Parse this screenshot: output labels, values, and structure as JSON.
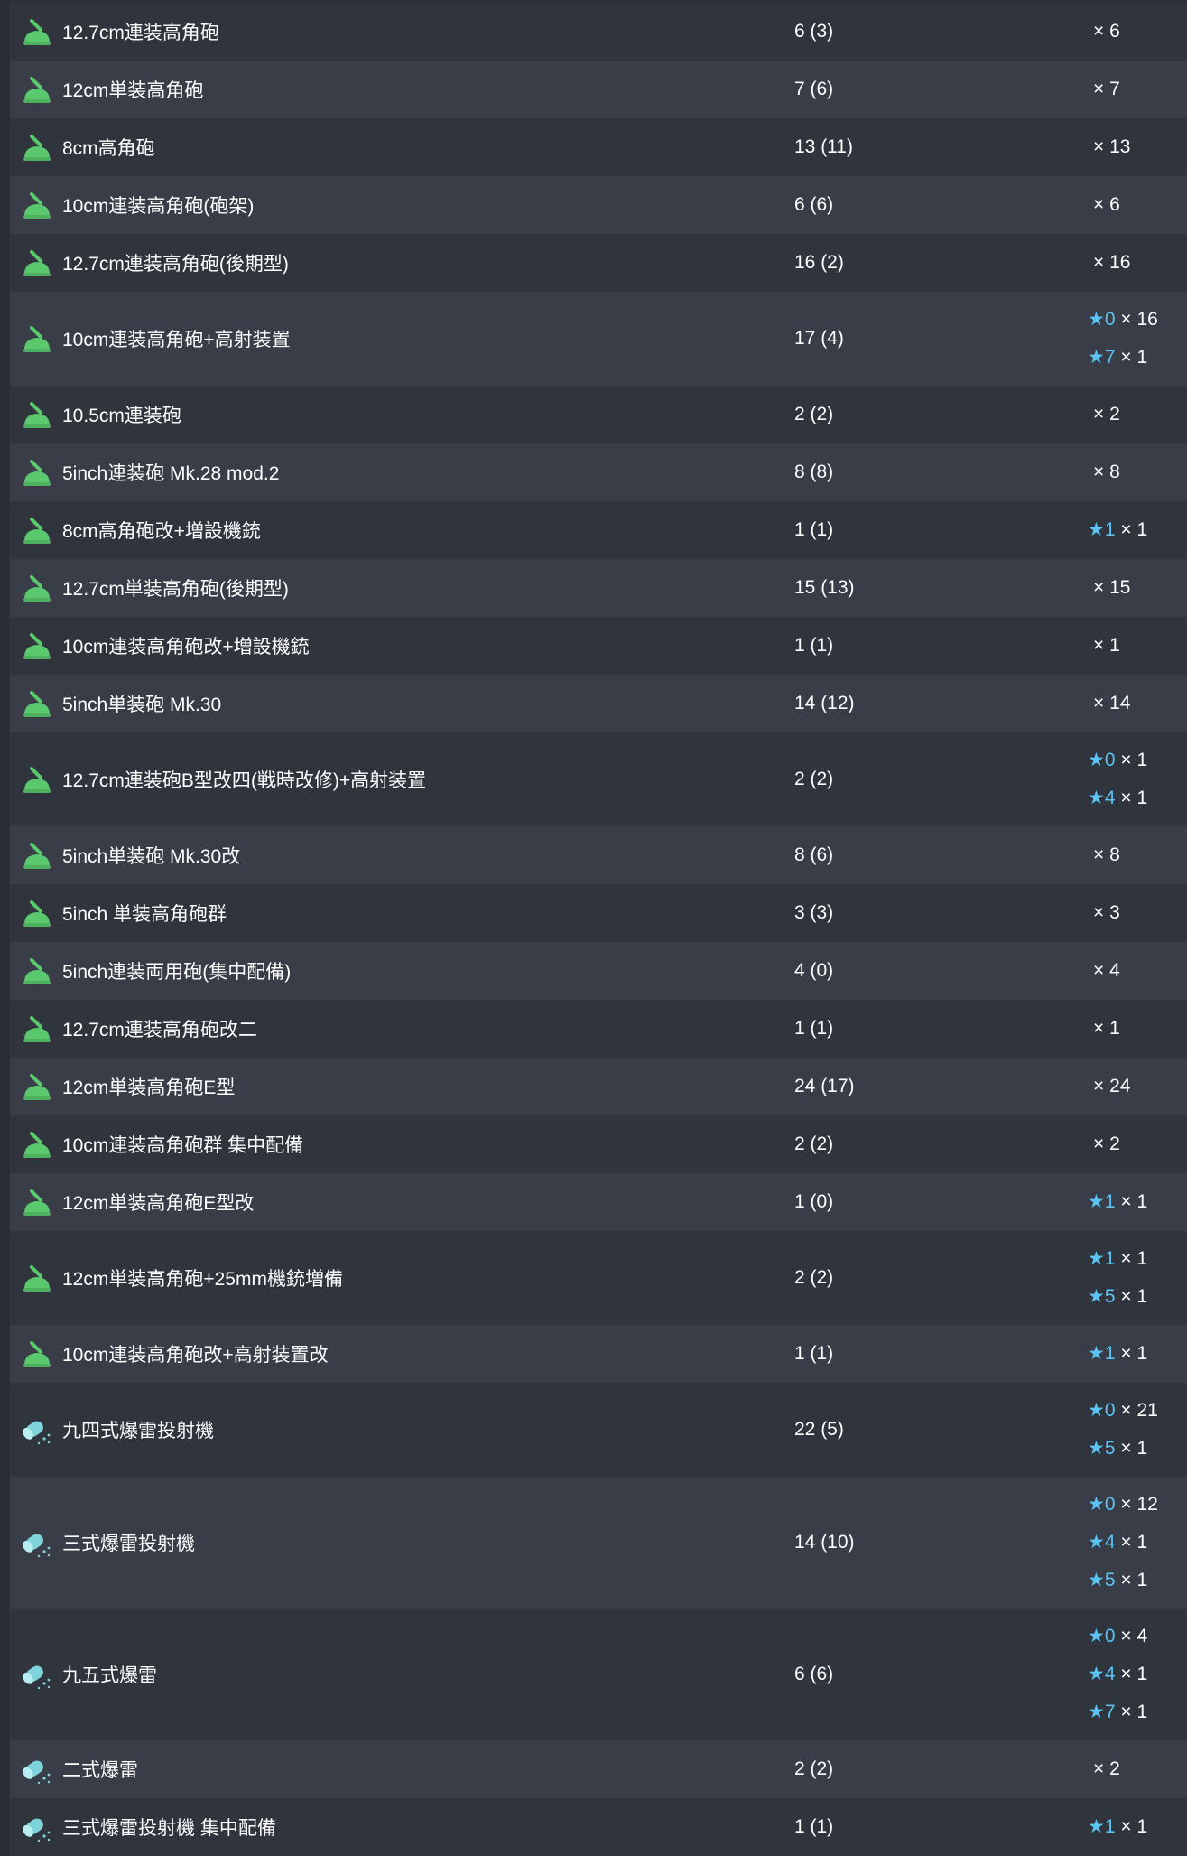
{
  "colors": {
    "star": "#5ac4f5",
    "row_odd": "#2f343d",
    "row_even": "#383d47",
    "gun_icon": "#5cc86e",
    "depth_charge_icon": "#7fd3da"
  },
  "rows": [
    {
      "name": "12.7cm連装高角砲",
      "icon": "gun",
      "count": "6 (3)",
      "levels": [
        {
          "star": "",
          "qty": "× 6"
        }
      ]
    },
    {
      "name": "12cm単装高角砲",
      "icon": "gun",
      "count": "7 (6)",
      "levels": [
        {
          "star": "",
          "qty": "× 7"
        }
      ]
    },
    {
      "name": "8cm高角砲",
      "icon": "gun",
      "count": "13 (11)",
      "levels": [
        {
          "star": "",
          "qty": "× 13"
        }
      ]
    },
    {
      "name": "10cm連装高角砲(砲架)",
      "icon": "gun",
      "count": "6 (6)",
      "levels": [
        {
          "star": "",
          "qty": "× 6"
        }
      ]
    },
    {
      "name": "12.7cm連装高角砲(後期型)",
      "icon": "gun",
      "count": "16 (2)",
      "levels": [
        {
          "star": "",
          "qty": "× 16"
        }
      ]
    },
    {
      "name": "10cm連装高角砲+高射装置",
      "icon": "gun",
      "count": "17 (4)",
      "levels": [
        {
          "star": "★0",
          "qty": "× 16"
        },
        {
          "star": "★7",
          "qty": "× 1"
        }
      ]
    },
    {
      "name": "10.5cm連装砲",
      "icon": "gun",
      "count": "2 (2)",
      "levels": [
        {
          "star": "",
          "qty": "× 2"
        }
      ]
    },
    {
      "name": "5inch連装砲 Mk.28 mod.2",
      "icon": "gun",
      "count": "8 (8)",
      "levels": [
        {
          "star": "",
          "qty": "× 8"
        }
      ]
    },
    {
      "name": "8cm高角砲改+増設機銃",
      "icon": "gun",
      "count": "1 (1)",
      "levels": [
        {
          "star": "★1",
          "qty": "× 1"
        }
      ]
    },
    {
      "name": "12.7cm単装高角砲(後期型)",
      "icon": "gun",
      "count": "15 (13)",
      "levels": [
        {
          "star": "",
          "qty": "× 15"
        }
      ]
    },
    {
      "name": "10cm連装高角砲改+増設機銃",
      "icon": "gun",
      "count": "1 (1)",
      "levels": [
        {
          "star": "",
          "qty": "× 1"
        }
      ]
    },
    {
      "name": "5inch単装砲 Mk.30",
      "icon": "gun",
      "count": "14 (12)",
      "levels": [
        {
          "star": "",
          "qty": "× 14"
        }
      ]
    },
    {
      "name": "12.7cm連装砲B型改四(戦時改修)+高射装置",
      "icon": "gun",
      "count": "2 (2)",
      "levels": [
        {
          "star": "★0",
          "qty": "× 1"
        },
        {
          "star": "★4",
          "qty": "× 1"
        }
      ]
    },
    {
      "name": "5inch単装砲 Mk.30改",
      "icon": "gun",
      "count": "8 (6)",
      "levels": [
        {
          "star": "",
          "qty": "× 8"
        }
      ]
    },
    {
      "name": "5inch 単装高角砲群",
      "icon": "gun",
      "count": "3 (3)",
      "levels": [
        {
          "star": "",
          "qty": "× 3"
        }
      ]
    },
    {
      "name": "5inch連装両用砲(集中配備)",
      "icon": "gun",
      "count": "4 (0)",
      "levels": [
        {
          "star": "",
          "qty": "× 4"
        }
      ]
    },
    {
      "name": "12.7cm連装高角砲改二",
      "icon": "gun",
      "count": "1 (1)",
      "levels": [
        {
          "star": "",
          "qty": "× 1"
        }
      ]
    },
    {
      "name": "12cm単装高角砲E型",
      "icon": "gun",
      "count": "24 (17)",
      "levels": [
        {
          "star": "",
          "qty": "× 24"
        }
      ]
    },
    {
      "name": "10cm連装高角砲群 集中配備",
      "icon": "gun",
      "count": "2 (2)",
      "levels": [
        {
          "star": "",
          "qty": "× 2"
        }
      ]
    },
    {
      "name": "12cm単装高角砲E型改",
      "icon": "gun",
      "count": "1 (0)",
      "levels": [
        {
          "star": "★1",
          "qty": "× 1"
        }
      ]
    },
    {
      "name": "12cm単装高角砲+25mm機銃増備",
      "icon": "gun",
      "count": "2 (2)",
      "levels": [
        {
          "star": "★1",
          "qty": "× 1"
        },
        {
          "star": "★5",
          "qty": "× 1"
        }
      ]
    },
    {
      "name": "10cm連装高角砲改+高射装置改",
      "icon": "gun",
      "count": "1 (1)",
      "levels": [
        {
          "star": "★1",
          "qty": "× 1"
        }
      ]
    },
    {
      "name": "九四式爆雷投射機",
      "icon": "depth-charge",
      "count": "22 (5)",
      "levels": [
        {
          "star": "★0",
          "qty": "× 21"
        },
        {
          "star": "★5",
          "qty": "× 1"
        }
      ]
    },
    {
      "name": "三式爆雷投射機",
      "icon": "depth-charge",
      "count": "14 (10)",
      "levels": [
        {
          "star": "★0",
          "qty": "× 12"
        },
        {
          "star": "★4",
          "qty": "× 1"
        },
        {
          "star": "★5",
          "qty": "× 1"
        }
      ]
    },
    {
      "name": "九五式爆雷",
      "icon": "depth-charge",
      "count": "6 (6)",
      "levels": [
        {
          "star": "★0",
          "qty": "× 4"
        },
        {
          "star": "★4",
          "qty": "× 1"
        },
        {
          "star": "★7",
          "qty": "× 1"
        }
      ]
    },
    {
      "name": "二式爆雷",
      "icon": "depth-charge",
      "count": "2 (2)",
      "levels": [
        {
          "star": "",
          "qty": "× 2"
        }
      ]
    },
    {
      "name": "三式爆雷投射機 集中配備",
      "icon": "depth-charge",
      "count": "1 (1)",
      "levels": [
        {
          "star": "★1",
          "qty": "× 1"
        }
      ]
    }
  ]
}
